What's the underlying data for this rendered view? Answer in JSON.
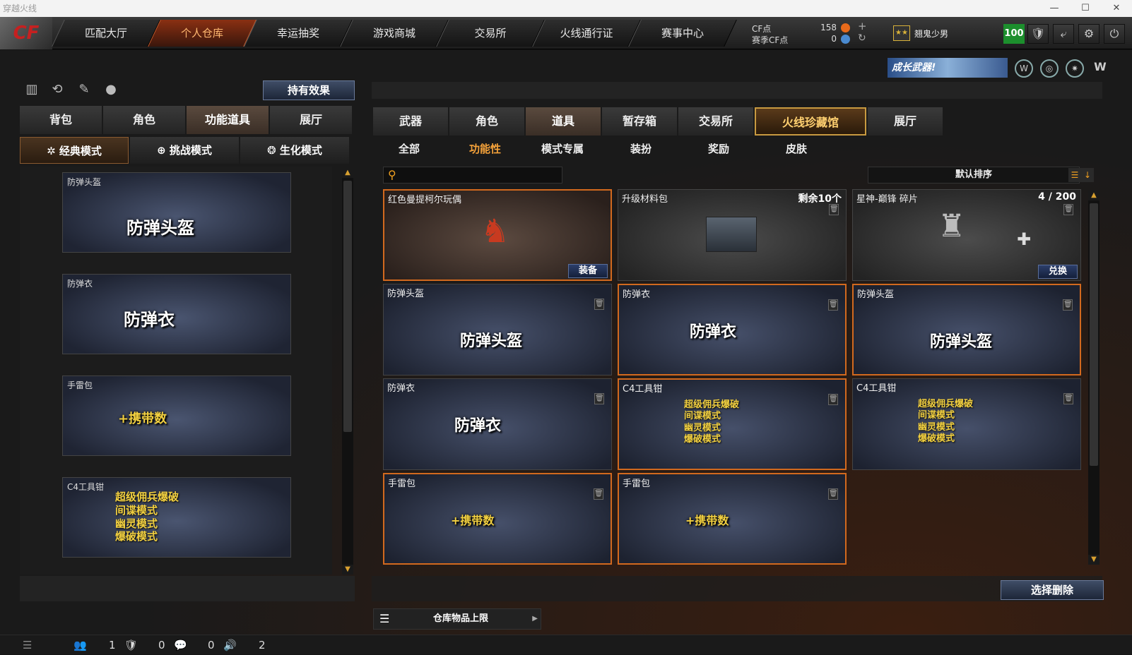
{
  "window": {
    "title": "穿越火线",
    "controls": [
      "—",
      "☐",
      "✕"
    ]
  },
  "nav": {
    "logo": "CF",
    "tabs": [
      "匹配大厅",
      "个人仓库",
      "幸运抽奖",
      "游戏商城",
      "交易所",
      "火线通行证",
      "赛事中心"
    ]
  },
  "currency": {
    "cf_label": "CF点",
    "cf_value": "158",
    "season_label": "赛季CF点",
    "season_value": "0",
    "plus": "+",
    "refresh": "↻"
  },
  "user": {
    "rank_icon": "★★",
    "name": "翘鬼少男",
    "level": "100"
  },
  "top_icons": [
    "🛡",
    "⤶",
    "⚙",
    "⏻"
  ],
  "banner": {
    "text": "成长武器!",
    "icons": [
      "W",
      "◎",
      "✷",
      "W"
    ]
  },
  "left": {
    "icons": [
      "▥",
      "⟲",
      "✎",
      "●"
    ],
    "effect_button": "持有效果",
    "tabs": [
      "背包",
      "角色",
      "功能道具",
      "展厅"
    ],
    "modes": [
      {
        "icon": "✲",
        "label": "经典模式"
      },
      {
        "icon": "⊕",
        "label": "挑战模式"
      },
      {
        "icon": "❂",
        "label": "生化模式"
      }
    ],
    "cards": [
      {
        "title": "防弹头盔",
        "art": "防弹头盔"
      },
      {
        "title": "防弹衣",
        "art": "防弹衣"
      },
      {
        "title": "手雷包",
        "art": "+携带数"
      },
      {
        "title": "C4工具钳",
        "art": [
          "超级佣兵爆破",
          "间谍模式",
          "幽灵模式",
          "爆破模式"
        ]
      }
    ]
  },
  "right": {
    "tabs": [
      "武器",
      "角色",
      "道具",
      "暂存箱",
      "交易所",
      "火线珍藏馆",
      "展厅"
    ],
    "subtabs": [
      "全部",
      "功能性",
      "模式专属",
      "装扮",
      "奖励",
      "皮肤"
    ],
    "search_placeholder": "",
    "sort_label": "默认排序",
    "cards": [
      {
        "title": "红色曼提柯尔玩偶",
        "corner": "",
        "action": "装备"
      },
      {
        "title": "升级材料包",
        "corner": "剩余10个",
        "action": ""
      },
      {
        "title": "星神-巅锋 碎片",
        "corner": "4 / 200",
        "action": "兑换"
      },
      {
        "title": "防弹头盔",
        "art": "防弹头盔"
      },
      {
        "title": "防弹衣",
        "art": "防弹衣"
      },
      {
        "title": "防弹头盔",
        "art": "防弹头盔"
      },
      {
        "title": "防弹衣",
        "art": "防弹衣"
      },
      {
        "title": "C4工具钳",
        "art": [
          "超级佣兵爆破",
          "间谍模式",
          "幽灵模式",
          "爆破模式"
        ]
      },
      {
        "title": "C4工具钳",
        "art": [
          "超级佣兵爆破",
          "间谍模式",
          "幽灵模式",
          "爆破模式"
        ]
      },
      {
        "title": "手雷包",
        "art": "+携带数"
      },
      {
        "title": "手雷包",
        "art": "+携带数"
      }
    ],
    "delete_button": "选择删除",
    "storage_limit": "仓库物品上限"
  },
  "status": {
    "friends": "1",
    "clan": "0",
    "chat": "0",
    "voice": "2"
  }
}
